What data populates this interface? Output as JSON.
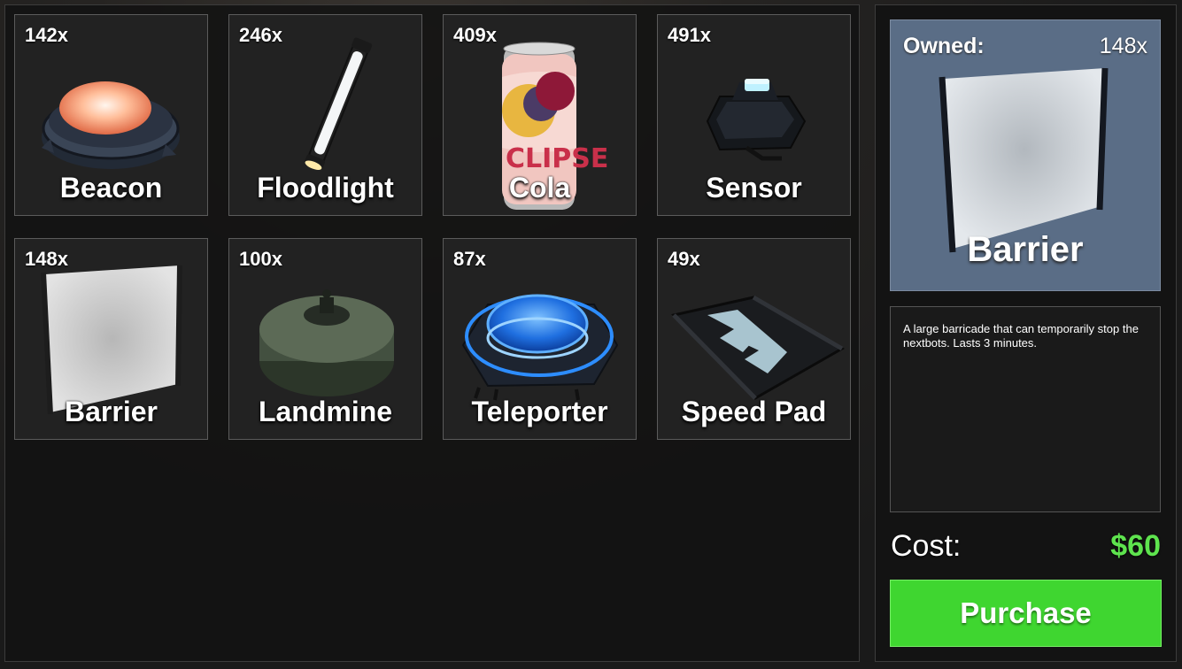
{
  "inventory": {
    "items": [
      {
        "count": "142x",
        "name": "Beacon",
        "icon": "beacon-icon"
      },
      {
        "count": "246x",
        "name": "Floodlight",
        "icon": "floodlight-icon"
      },
      {
        "count": "409x",
        "name": "Cola",
        "icon": "cola-can-icon",
        "can_text": "CLIPSE"
      },
      {
        "count": "491x",
        "name": "Sensor",
        "icon": "sensor-icon"
      },
      {
        "count": "148x",
        "name": "Barrier",
        "icon": "barrier-icon"
      },
      {
        "count": "100x",
        "name": "Landmine",
        "icon": "landmine-icon"
      },
      {
        "count": "87x",
        "name": "Teleporter",
        "icon": "teleporter-icon"
      },
      {
        "count": "49x",
        "name": "Speed Pad",
        "icon": "speed-pad-icon"
      }
    ]
  },
  "detail": {
    "owned_label": "Owned:",
    "owned_value": "148x",
    "name": "Barrier",
    "description": "A large barricade that can temporarily stop the nextbots. Lasts 3 minutes.",
    "cost_label": "Cost:",
    "cost_value": "$60",
    "purchase_label": "Purchase"
  },
  "colors": {
    "preview_bg": "#5a6d86",
    "cost_green": "#5ee34e",
    "purchase_green": "#3fd630"
  }
}
